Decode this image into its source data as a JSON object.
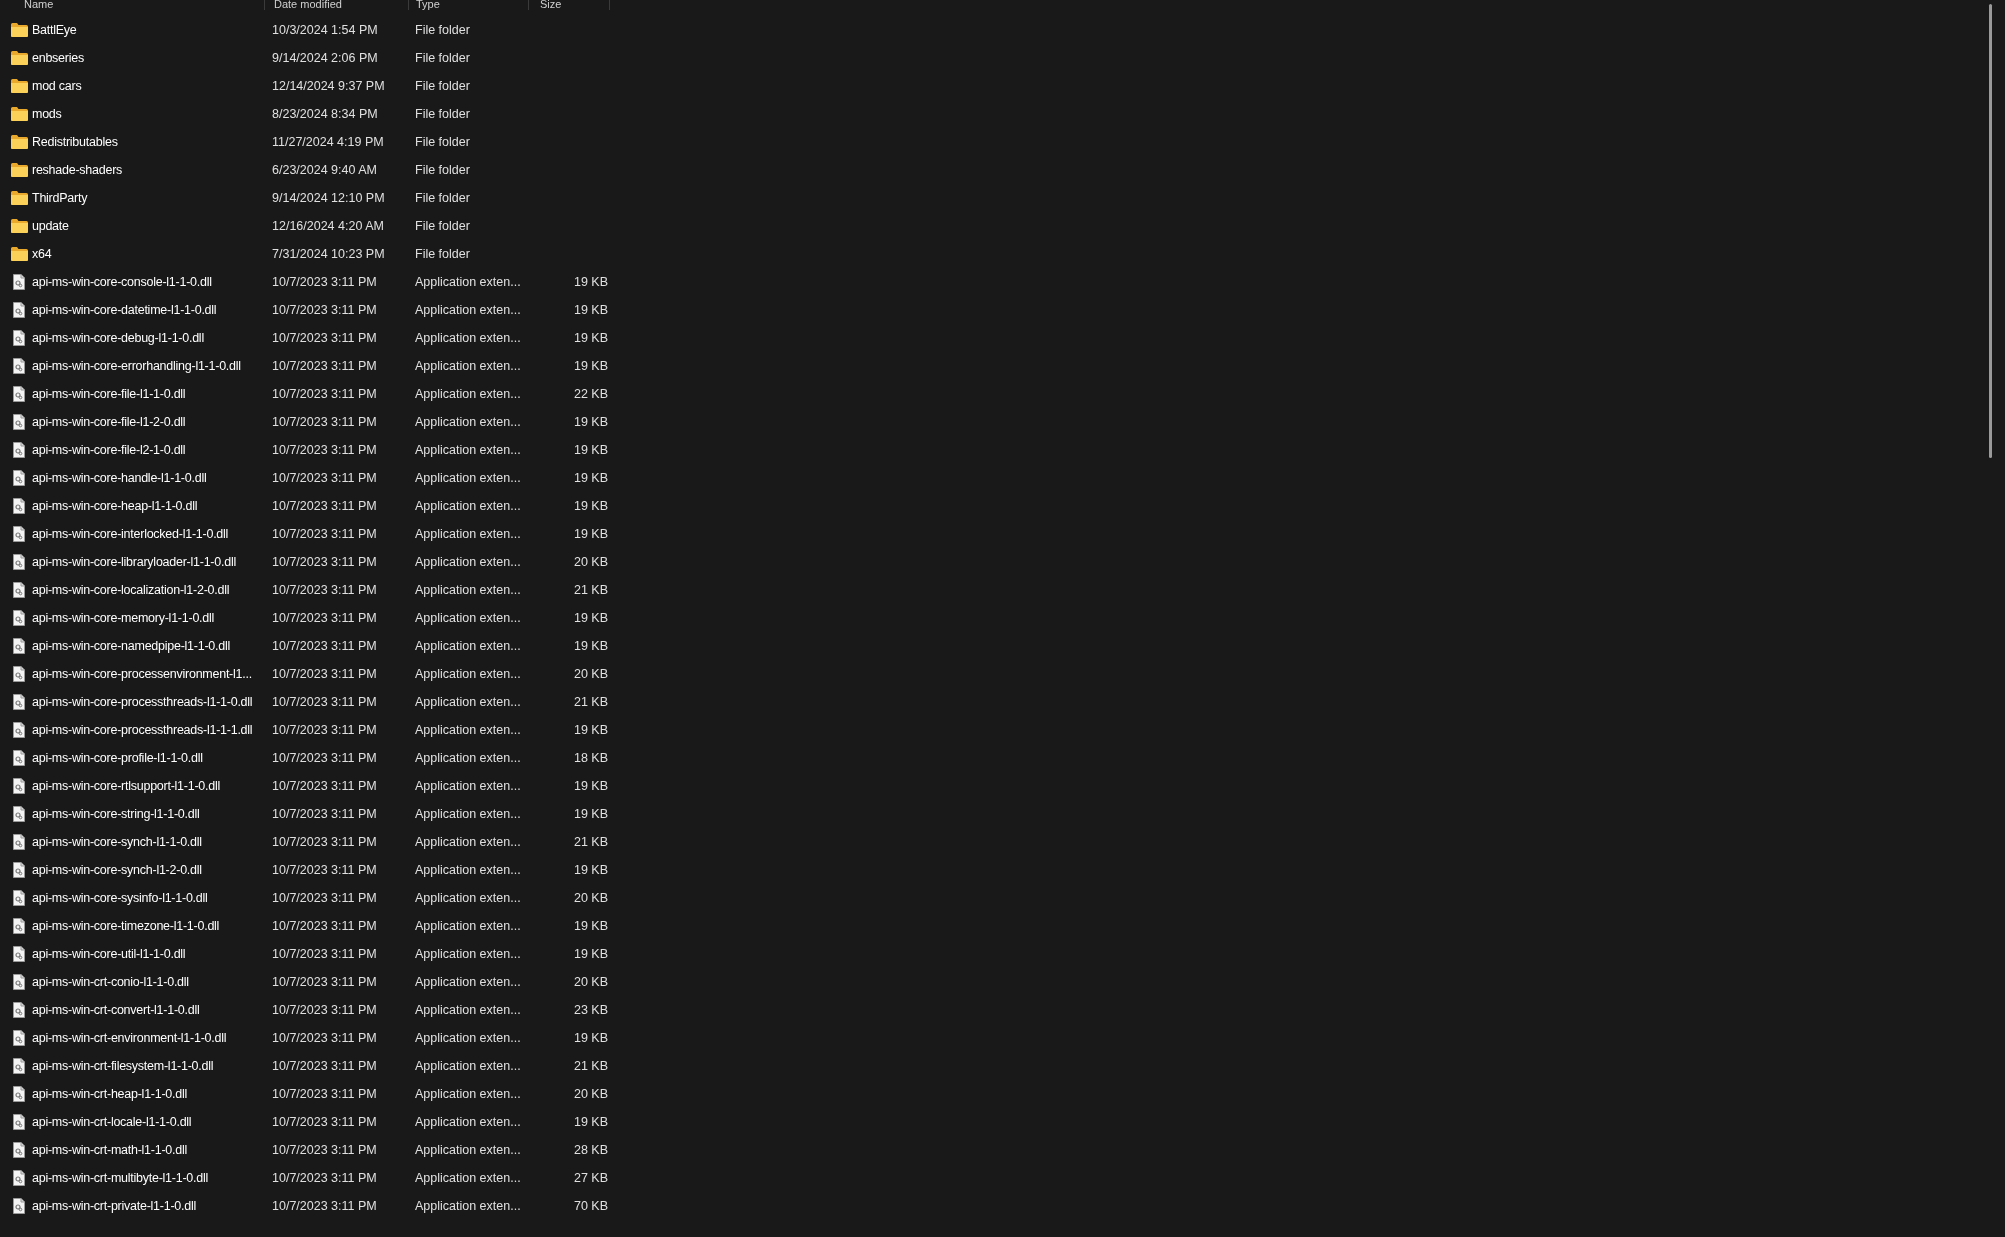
{
  "columns": [
    "Name",
    "Date modified",
    "Type",
    "Size"
  ],
  "rows": [
    {
      "kind": "folder",
      "name": "BattlEye",
      "date": "10/3/2024 1:54 PM",
      "type": "File folder"
    },
    {
      "kind": "folder",
      "name": "enbseries",
      "date": "9/14/2024 2:06 PM",
      "type": "File folder"
    },
    {
      "kind": "folder",
      "name": "mod cars",
      "date": "12/14/2024 9:37 PM",
      "type": "File folder"
    },
    {
      "kind": "folder",
      "name": "mods",
      "date": "8/23/2024 8:34 PM",
      "type": "File folder"
    },
    {
      "kind": "folder",
      "name": "Redistributables",
      "date": "11/27/2024 4:19 PM",
      "type": "File folder"
    },
    {
      "kind": "folder",
      "name": "reshade-shaders",
      "date": "6/23/2024 9:40 AM",
      "type": "File folder"
    },
    {
      "kind": "folder",
      "name": "ThirdParty",
      "date": "9/14/2024 12:10 PM",
      "type": "File folder"
    },
    {
      "kind": "folder",
      "name": "update",
      "date": "12/16/2024 4:20 AM",
      "type": "File folder"
    },
    {
      "kind": "folder",
      "name": "x64",
      "date": "7/31/2024 10:23 PM",
      "type": "File folder"
    },
    {
      "kind": "file",
      "name": "api-ms-win-core-console-l1-1-0.dll",
      "date": "10/7/2023 3:11 PM",
      "type": "Application exten...",
      "size": "19 KB"
    },
    {
      "kind": "file",
      "name": "api-ms-win-core-datetime-l1-1-0.dll",
      "date": "10/7/2023 3:11 PM",
      "type": "Application exten...",
      "size": "19 KB"
    },
    {
      "kind": "file",
      "name": "api-ms-win-core-debug-l1-1-0.dll",
      "date": "10/7/2023 3:11 PM",
      "type": "Application exten...",
      "size": "19 KB"
    },
    {
      "kind": "file",
      "name": "api-ms-win-core-errorhandling-l1-1-0.dll",
      "date": "10/7/2023 3:11 PM",
      "type": "Application exten...",
      "size": "19 KB"
    },
    {
      "kind": "file",
      "name": "api-ms-win-core-file-l1-1-0.dll",
      "date": "10/7/2023 3:11 PM",
      "type": "Application exten...",
      "size": "22 KB"
    },
    {
      "kind": "file",
      "name": "api-ms-win-core-file-l1-2-0.dll",
      "date": "10/7/2023 3:11 PM",
      "type": "Application exten...",
      "size": "19 KB"
    },
    {
      "kind": "file",
      "name": "api-ms-win-core-file-l2-1-0.dll",
      "date": "10/7/2023 3:11 PM",
      "type": "Application exten...",
      "size": "19 KB"
    },
    {
      "kind": "file",
      "name": "api-ms-win-core-handle-l1-1-0.dll",
      "date": "10/7/2023 3:11 PM",
      "type": "Application exten...",
      "size": "19 KB"
    },
    {
      "kind": "file",
      "name": "api-ms-win-core-heap-l1-1-0.dll",
      "date": "10/7/2023 3:11 PM",
      "type": "Application exten...",
      "size": "19 KB"
    },
    {
      "kind": "file",
      "name": "api-ms-win-core-interlocked-l1-1-0.dll",
      "date": "10/7/2023 3:11 PM",
      "type": "Application exten...",
      "size": "19 KB"
    },
    {
      "kind": "file",
      "name": "api-ms-win-core-libraryloader-l1-1-0.dll",
      "date": "10/7/2023 3:11 PM",
      "type": "Application exten...",
      "size": "20 KB"
    },
    {
      "kind": "file",
      "name": "api-ms-win-core-localization-l1-2-0.dll",
      "date": "10/7/2023 3:11 PM",
      "type": "Application exten...",
      "size": "21 KB"
    },
    {
      "kind": "file",
      "name": "api-ms-win-core-memory-l1-1-0.dll",
      "date": "10/7/2023 3:11 PM",
      "type": "Application exten...",
      "size": "19 KB"
    },
    {
      "kind": "file",
      "name": "api-ms-win-core-namedpipe-l1-1-0.dll",
      "date": "10/7/2023 3:11 PM",
      "type": "Application exten...",
      "size": "19 KB"
    },
    {
      "kind": "file",
      "name": "api-ms-win-core-processenvironment-l1...",
      "date": "10/7/2023 3:11 PM",
      "type": "Application exten...",
      "size": "20 KB"
    },
    {
      "kind": "file",
      "name": "api-ms-win-core-processthreads-l1-1-0.dll",
      "date": "10/7/2023 3:11 PM",
      "type": "Application exten...",
      "size": "21 KB"
    },
    {
      "kind": "file",
      "name": "api-ms-win-core-processthreads-l1-1-1.dll",
      "date": "10/7/2023 3:11 PM",
      "type": "Application exten...",
      "size": "19 KB"
    },
    {
      "kind": "file",
      "name": "api-ms-win-core-profile-l1-1-0.dll",
      "date": "10/7/2023 3:11 PM",
      "type": "Application exten...",
      "size": "18 KB"
    },
    {
      "kind": "file",
      "name": "api-ms-win-core-rtlsupport-l1-1-0.dll",
      "date": "10/7/2023 3:11 PM",
      "type": "Application exten...",
      "size": "19 KB"
    },
    {
      "kind": "file",
      "name": "api-ms-win-core-string-l1-1-0.dll",
      "date": "10/7/2023 3:11 PM",
      "type": "Application exten...",
      "size": "19 KB"
    },
    {
      "kind": "file",
      "name": "api-ms-win-core-synch-l1-1-0.dll",
      "date": "10/7/2023 3:11 PM",
      "type": "Application exten...",
      "size": "21 KB"
    },
    {
      "kind": "file",
      "name": "api-ms-win-core-synch-l1-2-0.dll",
      "date": "10/7/2023 3:11 PM",
      "type": "Application exten...",
      "size": "19 KB"
    },
    {
      "kind": "file",
      "name": "api-ms-win-core-sysinfo-l1-1-0.dll",
      "date": "10/7/2023 3:11 PM",
      "type": "Application exten...",
      "size": "20 KB"
    },
    {
      "kind": "file",
      "name": "api-ms-win-core-timezone-l1-1-0.dll",
      "date": "10/7/2023 3:11 PM",
      "type": "Application exten...",
      "size": "19 KB"
    },
    {
      "kind": "file",
      "name": "api-ms-win-core-util-l1-1-0.dll",
      "date": "10/7/2023 3:11 PM",
      "type": "Application exten...",
      "size": "19 KB"
    },
    {
      "kind": "file",
      "name": "api-ms-win-crt-conio-l1-1-0.dll",
      "date": "10/7/2023 3:11 PM",
      "type": "Application exten...",
      "size": "20 KB"
    },
    {
      "kind": "file",
      "name": "api-ms-win-crt-convert-l1-1-0.dll",
      "date": "10/7/2023 3:11 PM",
      "type": "Application exten...",
      "size": "23 KB"
    },
    {
      "kind": "file",
      "name": "api-ms-win-crt-environment-l1-1-0.dll",
      "date": "10/7/2023 3:11 PM",
      "type": "Application exten...",
      "size": "19 KB"
    },
    {
      "kind": "file",
      "name": "api-ms-win-crt-filesystem-l1-1-0.dll",
      "date": "10/7/2023 3:11 PM",
      "type": "Application exten...",
      "size": "21 KB"
    },
    {
      "kind": "file",
      "name": "api-ms-win-crt-heap-l1-1-0.dll",
      "date": "10/7/2023 3:11 PM",
      "type": "Application exten...",
      "size": "20 KB"
    },
    {
      "kind": "file",
      "name": "api-ms-win-crt-locale-l1-1-0.dll",
      "date": "10/7/2023 3:11 PM",
      "type": "Application exten...",
      "size": "19 KB"
    },
    {
      "kind": "file",
      "name": "api-ms-win-crt-math-l1-1-0.dll",
      "date": "10/7/2023 3:11 PM",
      "type": "Application exten...",
      "size": "28 KB"
    },
    {
      "kind": "file",
      "name": "api-ms-win-crt-multibyte-l1-1-0.dll",
      "date": "10/7/2023 3:11 PM",
      "type": "Application exten...",
      "size": "27 KB"
    },
    {
      "kind": "file",
      "name": "api-ms-win-crt-private-l1-1-0.dll",
      "date": "10/7/2023 3:11 PM",
      "type": "Application exten...",
      "size": "70 KB"
    }
  ]
}
